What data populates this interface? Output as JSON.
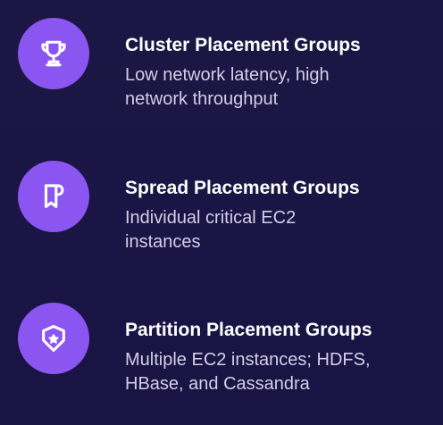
{
  "items": [
    {
      "title": "Cluster Placement Groups",
      "description_line1": "Low network latency, high",
      "description_line2": "network throughput",
      "icon": "trophy-icon"
    },
    {
      "title": "Spread Placement Groups",
      "description_line1": "Individual critical EC2",
      "description_line2": "instances",
      "icon": "flag-icon"
    },
    {
      "title": "Partition Placement Groups",
      "description_line1": "Multiple EC2 instances; HDFS,",
      "description_line2": "HBase, and Cassandra",
      "icon": "star-badge-icon"
    }
  ],
  "colors": {
    "background": "#1b1545",
    "icon_circle": "#8b55f2",
    "title": "#ffffff",
    "description": "#d4cde6"
  }
}
